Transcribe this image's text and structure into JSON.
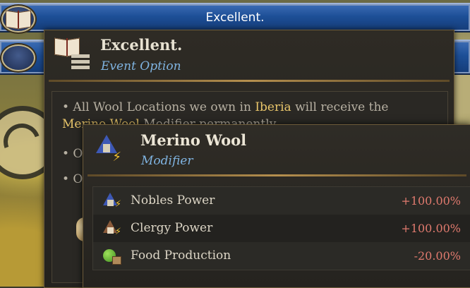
{
  "buttons": [
    {
      "label": "Excellent."
    },
    {
      "label": ""
    }
  ],
  "event_tooltip": {
    "title": "Excellent.",
    "subtitle": "Event Option",
    "bullets": {
      "b1_prefix": "• All Wool Locations we own in ",
      "b1_highlight1": "Iberia",
      "b1_mid": " will receive the ",
      "b1_highlight2": "Merino Wool",
      "b1_suffix": " Modifier permanently",
      "b2": "• Ou",
      "b3": "• Ou"
    }
  },
  "modifier_tooltip": {
    "title": "Merino Wool",
    "subtitle": "Modifier",
    "rows": [
      {
        "label": "Nobles Power",
        "value": "+100.00%",
        "icon": "nobles-power-icon"
      },
      {
        "label": "Clergy Power",
        "value": "+100.00%",
        "icon": "clergy-power-icon"
      },
      {
        "label": "Food Production",
        "value": "-20.00%",
        "icon": "food-production-icon"
      }
    ]
  },
  "colors": {
    "button_blue": "#1d4f97",
    "title_text": "#e8e2d2",
    "subtitle_blue": "#7fb3e0",
    "highlight_gold": "#e8c56a",
    "value_red": "#e07a6e"
  }
}
